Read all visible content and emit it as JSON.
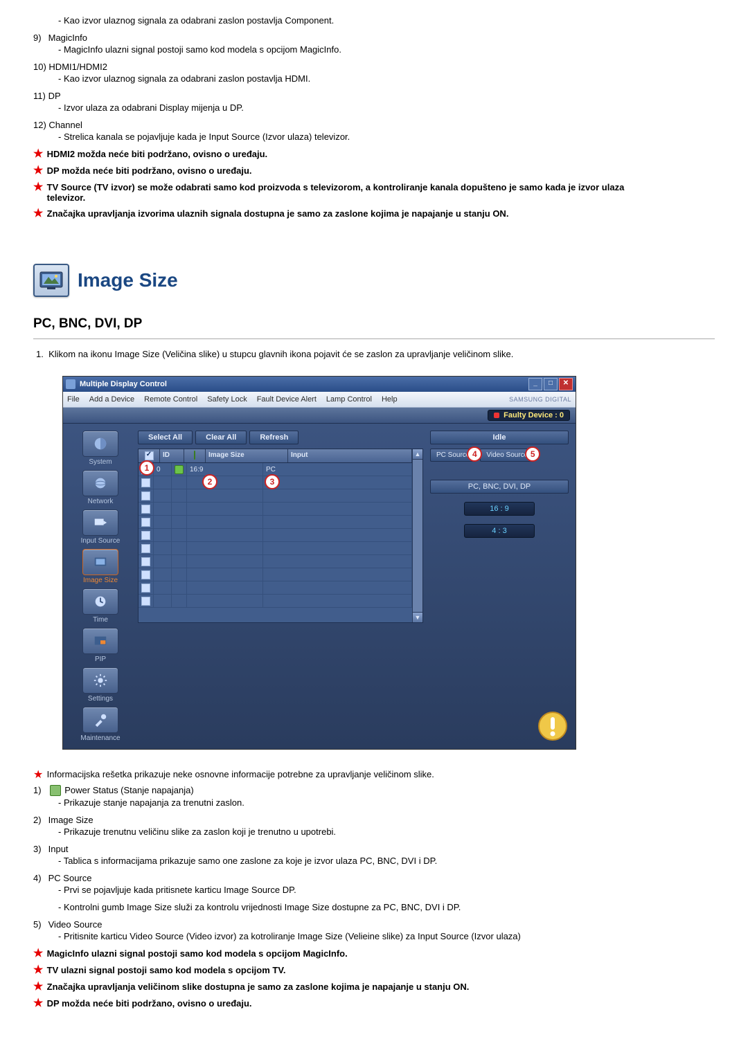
{
  "intro_items": [
    {
      "desc": "- Kao izvor ulaznog signala za odabrani zaslon postavlja Component."
    },
    {
      "num": "9)",
      "label": "MagicInfo",
      "desc": "- MagicInfo ulazni signal postoji samo kod modela s opcijom MagicInfo."
    },
    {
      "num": "10)",
      "label": "HDMI1/HDMI2",
      "desc": "- Kao izvor ulaznog signala za odabrani zaslon postavlja HDMI."
    },
    {
      "num": "11)",
      "label": "DP",
      "desc": "- Izvor ulaza za odabrani Display mijenja u DP."
    },
    {
      "num": "12)",
      "label": "Channel",
      "desc": "- Strelica kanala se pojavljuje kada je Input Source (Izvor ulaza) televizor."
    }
  ],
  "intro_stars": [
    "HDMI2 možda neće biti podržano, ovisno o uređaju.",
    "DP možda neće biti podržano, ovisno o uređaju.",
    "TV Source (TV izvor) se može odabrati samo kod proizvoda s televizorom, a kontroliranje kanala dopušteno je samo kada je izvor ulaza televizor.",
    "Značajka upravljanja izvorima ulaznih signala dostupna je samo za zaslone kojima je napajanje u stanju ON."
  ],
  "section_title": "Image Size",
  "subsection_title": "PC, BNC, DVI, DP",
  "sub_intro": "Klikom na ikonu Image Size (Veličina slike) u stupcu glavnih ikona pojavit će se zaslon za upravljanje veličinom slike.",
  "shot": {
    "window_title": "Multiple Display Control",
    "menus": [
      "File",
      "Add a Device",
      "Remote Control",
      "Safety Lock",
      "Fault Device Alert",
      "Lamp Control",
      "Help"
    ],
    "brand": "SAMSUNG DIGITAL",
    "faulty_label": "Faulty Device : 0",
    "sidebar_items": [
      "System",
      "Network",
      "Input Source",
      "Image Size",
      "Time",
      "PIP",
      "Settings",
      "Maintenance"
    ],
    "active_sidebar_index": 3,
    "buttons": {
      "select_all": "Select All",
      "clear_all": "Clear All",
      "refresh": "Refresh"
    },
    "idle_label": "Idle",
    "pc_source_tab": "PC Source",
    "video_source_tab": "Video Source",
    "group_label": "PC, BNC, DVI, DP",
    "opt_16_9": "16 : 9",
    "opt_4_3": "4 : 3",
    "grid": {
      "headers": {
        "chk": "",
        "id": "ID",
        "pwr": "",
        "size": "Image Size",
        "input": "Input"
      },
      "row0": {
        "id": "0",
        "size": "16:9",
        "input": "PC"
      }
    }
  },
  "post_star_line": "Informacijska rešetka prikazuje neke osnovne informacije potrebne za upravljanje veličinom slike.",
  "post_items": [
    {
      "num": "1)",
      "label": "Power Status (Stanje napajanja)",
      "badge": true,
      "desc": [
        "- Prikazuje stanje napajanja za trenutni zaslon."
      ]
    },
    {
      "num": "2)",
      "label": "Image Size",
      "desc": [
        "- Prikazuje trenutnu veličinu slike za zaslon koji je trenutno u upotrebi."
      ]
    },
    {
      "num": "3)",
      "label": "Input",
      "desc": [
        "- Tablica s informacijama prikazuje samo one zaslone za koje je izvor ulaza PC, BNC, DVI i DP."
      ]
    },
    {
      "num": "4)",
      "label": "PC Source",
      "desc": [
        "- Prvi se pojavljuje kada pritisnete karticu Image Source DP.",
        "- Kontrolni gumb Image Size služi za kontrolu vrijednosti Image Size dostupne za PC, BNC, DVI i DP."
      ]
    },
    {
      "num": "5)",
      "label": "Video Source",
      "desc": [
        "- Pritisnite karticu Video Source (Video izvor) za kotroliranje Image Size (Velieine slike) za Input Source (Izvor ulaza)"
      ]
    }
  ],
  "post_stars": [
    "MagicInfo ulazni signal postoji samo kod modela s opcijom MagicInfo.",
    "TV ulazni signal postoji samo kod modela s opcijom TV.",
    "Značajka upravljanja veličinom slike dostupna je samo za zaslone kojima je napajanje u stanju ON.",
    "DP možda neće biti podržano, ovisno o uređaju."
  ]
}
